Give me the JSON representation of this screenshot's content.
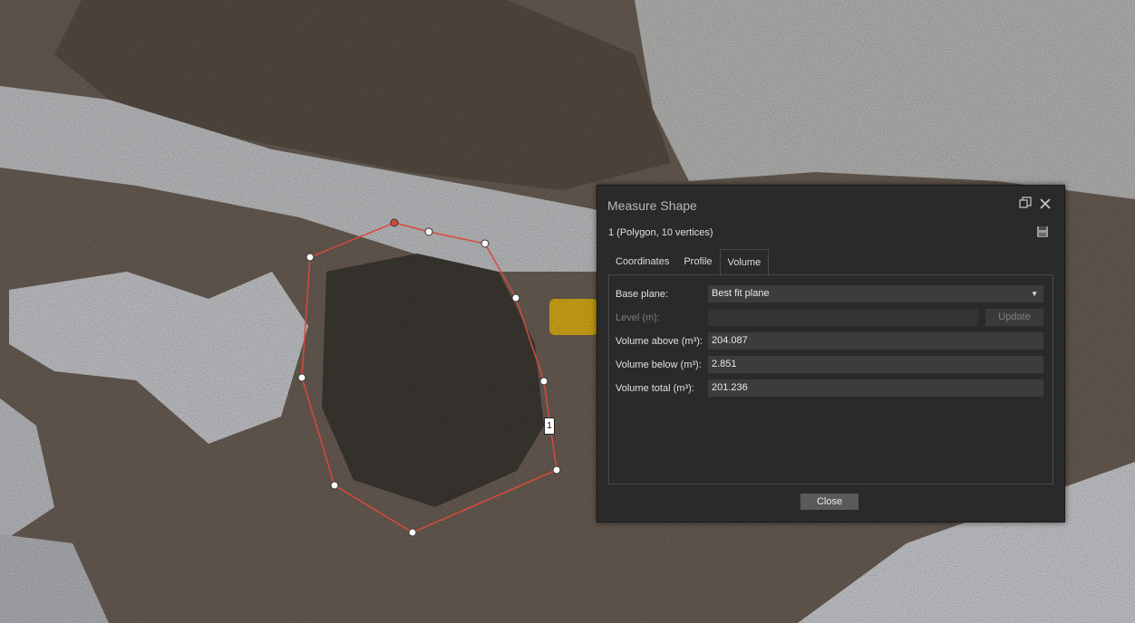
{
  "polygon": {
    "label": "1"
  },
  "dialog": {
    "title": "Measure Shape",
    "subtitle": "1 (Polygon, 10 vertices)",
    "tabs": [
      {
        "label": "Coordinates",
        "active": false
      },
      {
        "label": "Profile",
        "active": false
      },
      {
        "label": "Volume",
        "active": true
      }
    ],
    "volume": {
      "base_plane_label": "Base plane:",
      "base_plane_value": "Best fit plane",
      "level_label": "Level (m):",
      "level_value": "",
      "update_label": "Update",
      "volume_above_label": "Volume above (m³):",
      "volume_above_value": "204.087",
      "volume_below_label": "Volume below (m³):",
      "volume_below_value": "2.851",
      "volume_total_label": "Volume total (m³):",
      "volume_total_value": "201.236"
    },
    "close_label": "Close"
  },
  "icons": {
    "restore": "restore-window-icon",
    "close": "close-icon",
    "save": "save-icon",
    "dropdown": "chevron-down-icon"
  },
  "colors": {
    "polygon_stroke": "#d64a3c",
    "dialog_bg": "#2a2a2a",
    "field_bg": "#3c3c3c"
  }
}
